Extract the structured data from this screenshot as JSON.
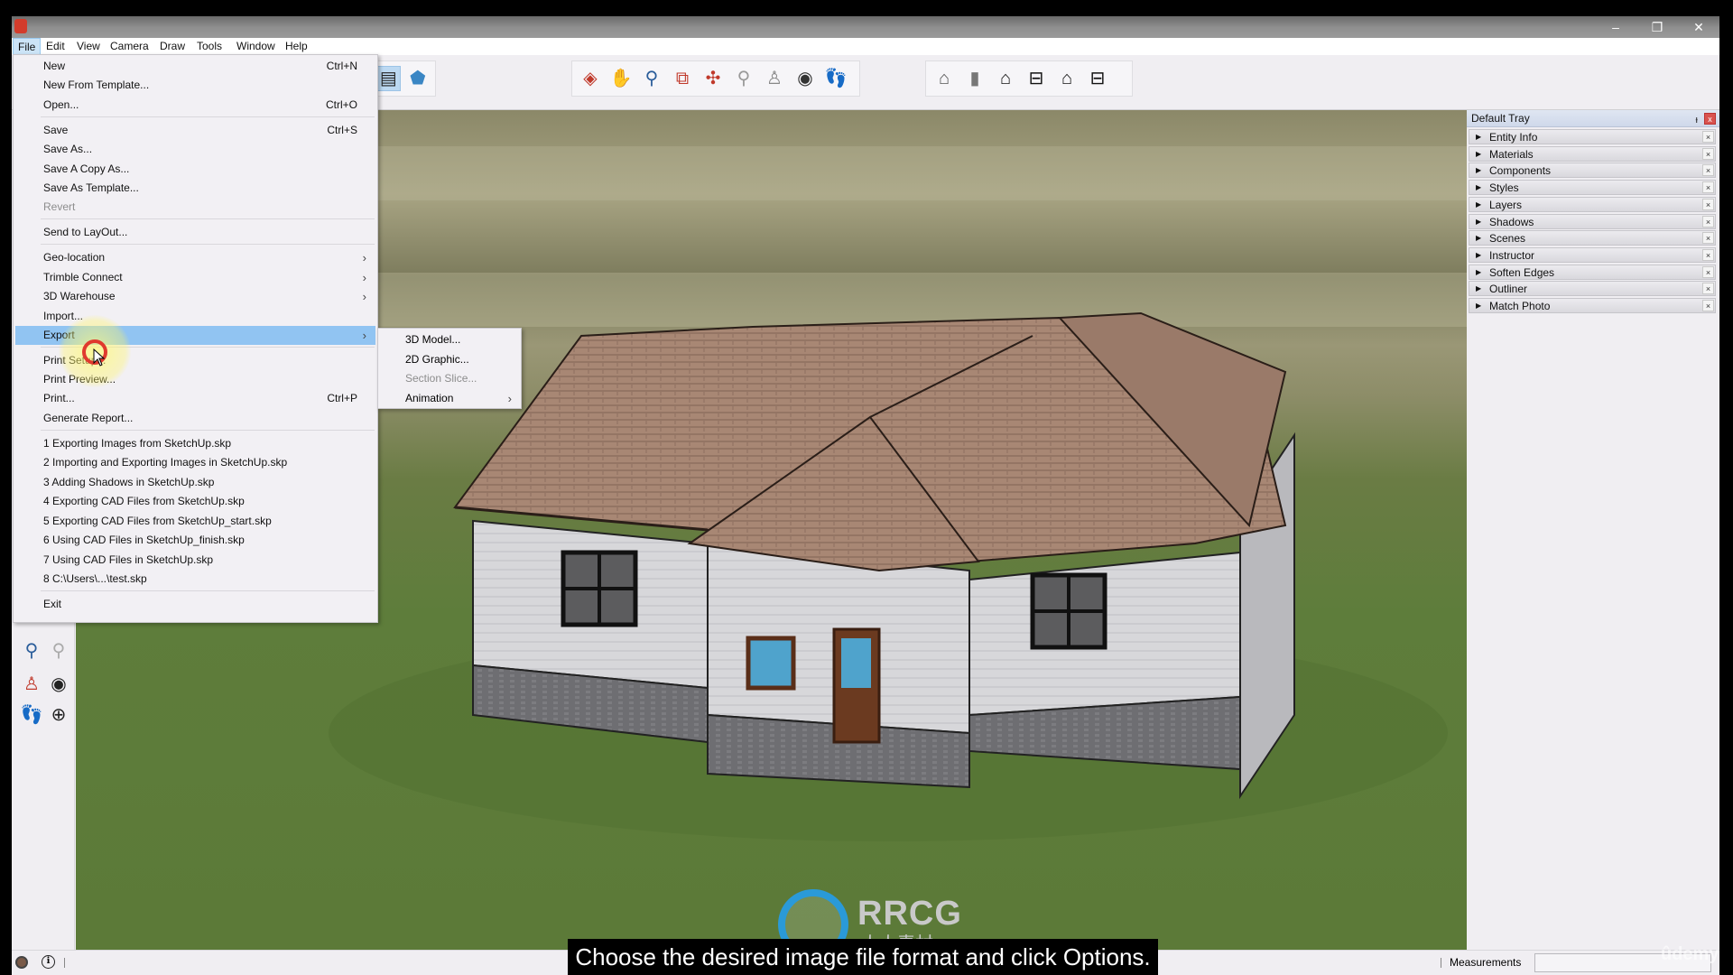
{
  "window": {
    "controls": {
      "minimize": "–",
      "restore": "❐",
      "close": "✕"
    }
  },
  "menubar": {
    "items": [
      {
        "label": "File",
        "active": true
      },
      {
        "label": "Edit"
      },
      {
        "label": "View"
      },
      {
        "label": "Camera"
      },
      {
        "label": "Draw"
      },
      {
        "label": "Tools"
      },
      {
        "label": "Window"
      },
      {
        "label": "Help"
      }
    ]
  },
  "file_menu": {
    "items": [
      {
        "label": "New",
        "shortcut": "Ctrl+N"
      },
      {
        "label": "New From Template..."
      },
      {
        "label": "Open...",
        "shortcut": "Ctrl+O"
      },
      {
        "label": "Save",
        "shortcut": "Ctrl+S"
      },
      {
        "label": "Save As..."
      },
      {
        "label": "Save A Copy As..."
      },
      {
        "label": "Save As Template..."
      },
      {
        "label": "Revert",
        "disabled": true
      },
      {
        "label": "Send to LayOut..."
      },
      {
        "label": "Geo-location",
        "submenu": true
      },
      {
        "label": "Trimble Connect",
        "submenu": true
      },
      {
        "label": "3D Warehouse",
        "submenu": true
      },
      {
        "label": "Import..."
      },
      {
        "label": "Export",
        "submenu": true,
        "highlighted": true
      },
      {
        "label": "Print Setup..."
      },
      {
        "label": "Print Preview..."
      },
      {
        "label": "Print...",
        "shortcut": "Ctrl+P"
      },
      {
        "label": "Generate Report..."
      },
      {
        "label": "1 Exporting Images from SketchUp.skp"
      },
      {
        "label": "2 Importing and Exporting Images in SketchUp.skp"
      },
      {
        "label": "3 Adding Shadows in SketchUp.skp"
      },
      {
        "label": "4 Exporting CAD Files from SketchUp.skp"
      },
      {
        "label": "5 Exporting CAD Files from SketchUp_start.skp"
      },
      {
        "label": "6 Using CAD Files in SketchUp_finish.skp"
      },
      {
        "label": "7 Using CAD Files in SketchUp.skp"
      },
      {
        "label": "8 C:\\Users\\...\\test.skp"
      },
      {
        "label": "Exit"
      }
    ],
    "submenu_arrow": "›"
  },
  "export_submenu": {
    "items": [
      {
        "label": "3D Model..."
      },
      {
        "label": "2D Graphic..."
      },
      {
        "label": "Section Slice...",
        "disabled": true
      },
      {
        "label": "Animation",
        "submenu": true
      }
    ]
  },
  "toolbars": {
    "styles": [
      "xray-icon",
      "back-edges-icon",
      "wireframe-icon",
      "hidden-line-icon",
      "shaded-icon",
      "shaded-textures-icon",
      "monochrome-icon"
    ],
    "camera": [
      "orbit-icon",
      "pan-icon",
      "zoom-icon",
      "zoom-window-icon",
      "zoom-extents-icon",
      "previous-view-icon",
      "position-camera-icon",
      "look-around-icon",
      "walk-icon"
    ],
    "views": [
      "iso-view-icon",
      "top-view-icon",
      "front-view-icon",
      "right-view-icon",
      "back-view-icon",
      "left-view-icon"
    ]
  },
  "tray": {
    "title": "Default Tray",
    "pin_icon": "ᵻ",
    "close_icon": "x",
    "panels": [
      "Entity Info",
      "Materials",
      "Components",
      "Styles",
      "Layers",
      "Shadows",
      "Scenes",
      "Instructor",
      "Soften Edges",
      "Outliner",
      "Match Photo"
    ],
    "expand_arrow": "▶",
    "panel_close": "×"
  },
  "statusbar": {
    "measurements_label": "Measurements",
    "measurements_value": ""
  },
  "overlay": {
    "caption": "Choose the desired image file format and click Options.",
    "watermark_main": "RRCG",
    "watermark_sub": "人人素材",
    "udemy": "ûdemy"
  },
  "colors": {
    "menu_highlight": "#91c4f2",
    "ground": "#5c7a38",
    "roof": "#a88774",
    "siding": "#d6d6d9",
    "stone": "#707074",
    "door": "#6b3a20",
    "glass": "#4fa3cc"
  }
}
